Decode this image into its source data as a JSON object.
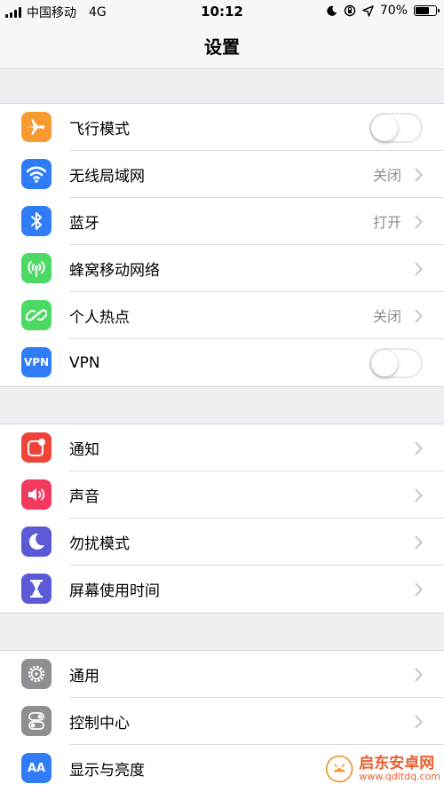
{
  "status_bar": {
    "carrier": "中国移动",
    "network": "4G",
    "time": "10:12",
    "battery_pct": "70%",
    "battery_level": 0.7
  },
  "nav": {
    "title": "设置"
  },
  "groups": [
    {
      "rows": [
        {
          "label": "飞行模式",
          "icon": "airplane-icon",
          "icon_color": "#f79a30",
          "accessory": "toggle",
          "toggle_on": false
        },
        {
          "label": "无线局域网",
          "icon": "wifi-icon",
          "icon_color": "#2f7cf6",
          "value": "关闭",
          "accessory": "chevron"
        },
        {
          "label": "蓝牙",
          "icon": "bluetooth-icon",
          "icon_color": "#2f7cf6",
          "value": "打开",
          "accessory": "chevron"
        },
        {
          "label": "蜂窝移动网络",
          "icon": "cellular-icon",
          "icon_color": "#4cd964",
          "accessory": "chevron"
        },
        {
          "label": "个人热点",
          "icon": "hotspot-icon",
          "icon_color": "#4cd964",
          "value": "关闭",
          "accessory": "chevron"
        },
        {
          "label": "VPN",
          "icon": "vpn-icon",
          "icon_text": "VPN",
          "icon_color": "#2f7cf6",
          "accessory": "toggle",
          "toggle_on": false
        }
      ]
    },
    {
      "rows": [
        {
          "label": "通知",
          "icon": "notification-icon",
          "icon_color": "#f0443a",
          "accessory": "chevron"
        },
        {
          "label": "声音",
          "icon": "sound-icon",
          "icon_color": "#f23a5f",
          "accessory": "chevron"
        },
        {
          "label": "勿扰模式",
          "icon": "moon-icon",
          "icon_color": "#5b59d6",
          "accessory": "chevron"
        },
        {
          "label": "屏幕使用时间",
          "icon": "hourglass-icon",
          "icon_color": "#5b59d6",
          "accessory": "chevron"
        }
      ]
    },
    {
      "rows": [
        {
          "label": "通用",
          "icon": "gear-icon",
          "icon_color": "#8e8e93",
          "accessory": "chevron"
        },
        {
          "label": "控制中心",
          "icon": "control-center-icon",
          "icon_color": "#8e8e93",
          "accessory": "chevron"
        },
        {
          "label": "显示与亮度",
          "icon": "display-brightness-icon",
          "icon_text": "AA",
          "icon_color": "#2f7cf6",
          "accessory": "chevron"
        }
      ]
    }
  ],
  "watermark": {
    "name": "启东安卓网",
    "url": "www.qdltdq.com"
  }
}
